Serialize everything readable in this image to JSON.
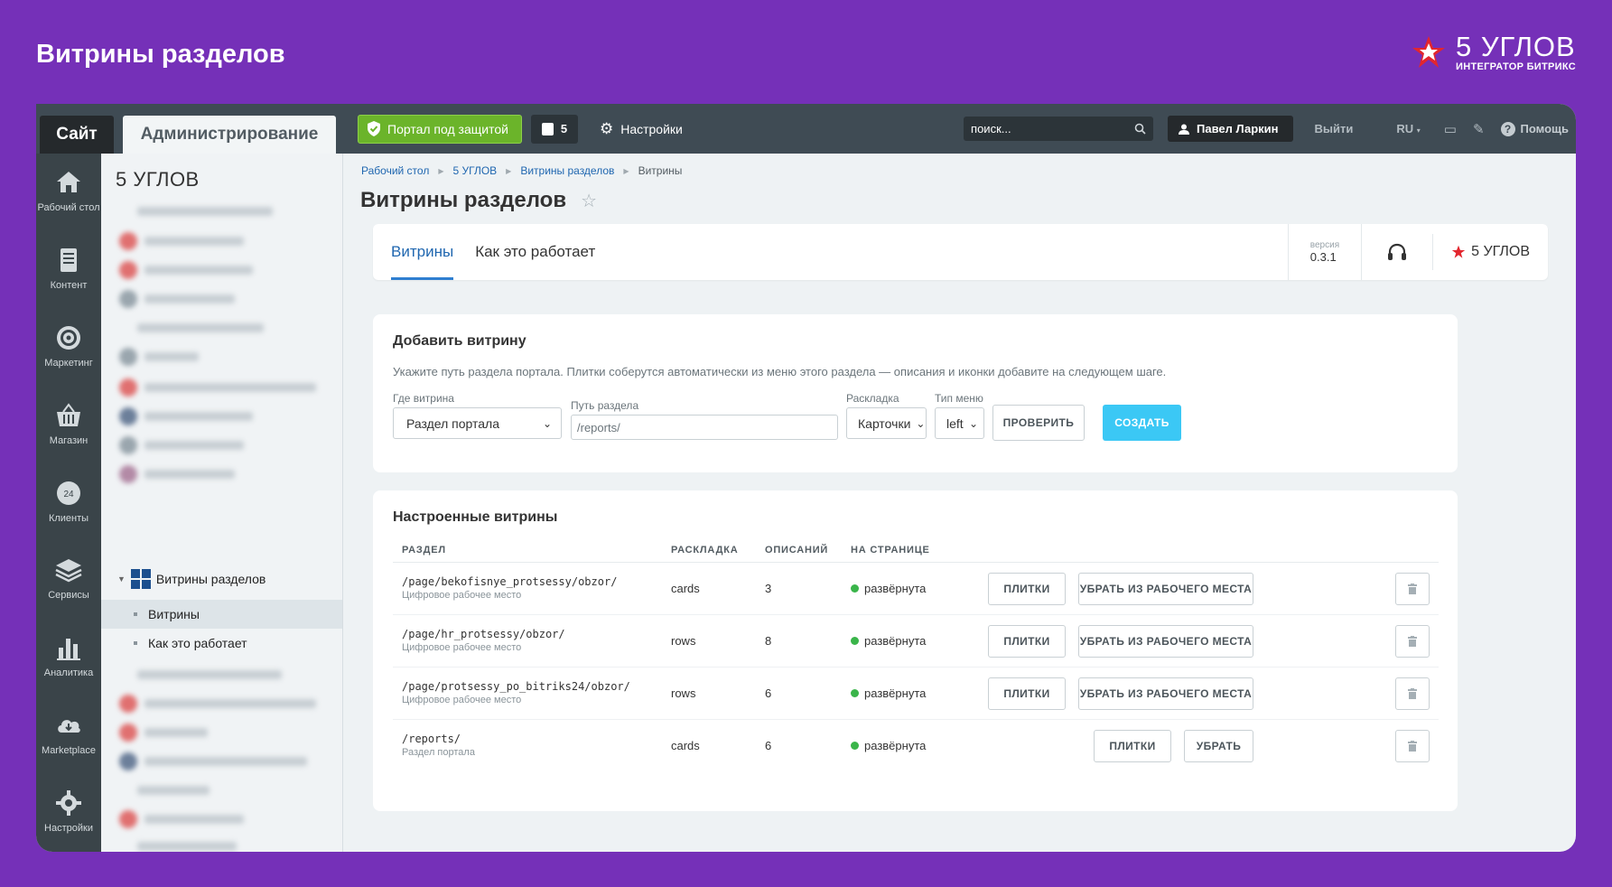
{
  "frame": {
    "title": "Витрины разделов",
    "brand_name": "5 УГЛОВ",
    "brand_sub": "ИНТЕГРАТОР БИТРИКС"
  },
  "toppanel": {
    "site_tab": "Сайт",
    "admin_tab": "Администрирование",
    "protect_label": "Портал под защитой",
    "notify_count": "5",
    "settings_label": "Настройки",
    "search_placeholder": "поиск...",
    "user_name": "Павел Ларкин",
    "logout_label": "Выйти",
    "lang": "RU",
    "help_label": "Помощь"
  },
  "leftnav": {
    "items": [
      {
        "label": "Рабочий стол",
        "icon": "home-icon"
      },
      {
        "label": "Контент",
        "icon": "document-icon"
      },
      {
        "label": "Маркетинг",
        "icon": "target-icon"
      },
      {
        "label": "Магазин",
        "icon": "basket-icon"
      },
      {
        "label": "Клиенты",
        "icon": "clients-icon"
      },
      {
        "label": "Сервисы",
        "icon": "layers-icon"
      },
      {
        "label": "Аналитика",
        "icon": "chart-icon"
      },
      {
        "label": "Marketplace",
        "icon": "cloud-download-icon"
      },
      {
        "label": "Настройки",
        "icon": "gear-icon"
      }
    ]
  },
  "tree": {
    "title": "5 УГЛОВ",
    "node_label": "Витрины разделов",
    "sub_items": [
      "Витрины",
      "Как это работает"
    ]
  },
  "breadcrumb": [
    "Рабочий стол",
    "5 УГЛОВ",
    "Витрины разделов",
    "Витрины"
  ],
  "page": {
    "title": "Витрины разделов"
  },
  "tabs": {
    "items": [
      "Витрины",
      "Как это работает"
    ],
    "active": "Витрины",
    "version_label": "версия",
    "version": "0.3.1",
    "brand": "5 УГЛОВ"
  },
  "add_card": {
    "title": "Добавить витрину",
    "description": "Укажите путь раздела портала. Плитки соберутся автоматически из меню этого раздела — описания и иконки добавите на следующем шаге.",
    "where_label": "Где витрина",
    "where_value": "Раздел портала",
    "path_label": "Путь раздела",
    "path_value": "/reports/",
    "layout_label": "Раскладка",
    "layout_value": "Карточки",
    "menu_label": "Тип меню",
    "menu_value": "left",
    "check_btn": "ПРОВЕРИТЬ",
    "create_btn": "СОЗДАТЬ"
  },
  "list_card": {
    "title": "Настроенные витрины",
    "headers": [
      "РАЗДЕЛ",
      "РАСКЛАДКА",
      "ОПИСАНИЙ",
      "НА СТРАНИЦЕ"
    ],
    "rows": [
      {
        "path": "/page/bekofisnye_protsessy/obzor/",
        "type": "Цифровое рабочее место",
        "layout": "cards",
        "count": "3",
        "status": "развёрнута",
        "tiles_btn": "ПЛИТКИ",
        "remove_btn": "УБРАТЬ ИЗ РАБОЧЕГО МЕСТА"
      },
      {
        "path": "/page/hr_protsessy/obzor/",
        "type": "Цифровое рабочее место",
        "layout": "rows",
        "count": "8",
        "status": "развёрнута",
        "tiles_btn": "ПЛИТКИ",
        "remove_btn": "УБРАТЬ ИЗ РАБОЧЕГО МЕСТА"
      },
      {
        "path": "/page/protsessy_po_bitriks24/obzor/",
        "type": "Цифровое рабочее место",
        "layout": "rows",
        "count": "6",
        "status": "развёрнута",
        "tiles_btn": "ПЛИТКИ",
        "remove_btn": "УБРАТЬ ИЗ РАБОЧЕГО МЕСТА"
      },
      {
        "path": "/reports/",
        "type": "Раздел портала",
        "layout": "cards",
        "count": "6",
        "status": "развёрнута",
        "tiles_btn": "ПЛИТКИ",
        "remove_btn": "УБРАТЬ"
      }
    ]
  },
  "colors": {
    "frame_bg": "#7530b8",
    "topbar": "#3f4b54",
    "accent_blue": "#2067b0",
    "primary_btn": "#3bc8f5",
    "status_green": "#3ab54a",
    "brand_red": "#e3262e"
  }
}
